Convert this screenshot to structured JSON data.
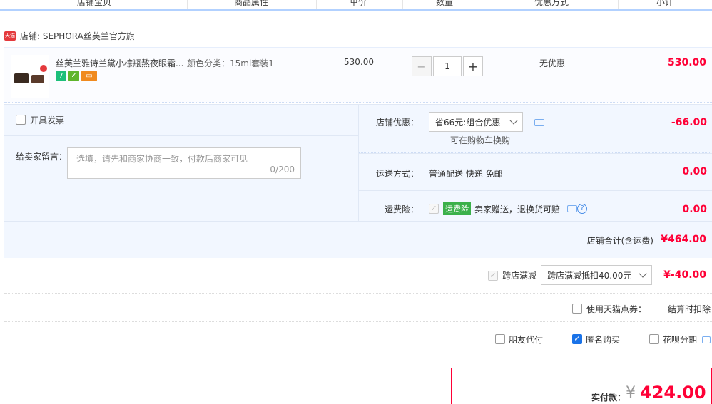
{
  "header": {
    "cols": [
      "店铺宝贝",
      "商品属性",
      "单价",
      "数量",
      "优惠方式",
      "小计"
    ]
  },
  "shop": {
    "badge": "天猫",
    "label": "店铺: SEPHORA丝芙兰官方旗"
  },
  "item": {
    "title": "丝芙兰雅诗兰黛小棕瓶熬夜眼霜...",
    "attr": "颜色分类：15ml套装1",
    "price": "530.00",
    "qty": "1",
    "minus": "−",
    "plus": "+",
    "discount": "无优惠",
    "subtotal": "530.00"
  },
  "options": {
    "invoice_label": "开具发票",
    "message_label": "给卖家留言：",
    "message_placeholder": "选填，请先和商家协商一致，付款后商家可见",
    "message_count": "0/200",
    "shop_discount_label": "店铺优惠：",
    "shop_discount_value": "省66元:组合优惠",
    "shop_discount_note": "可在购物车换购",
    "shop_discount_amount": "-66.00",
    "shipping_label": "运送方式：",
    "shipping_value": "普通配送 快递 免邮",
    "shipping_amount": "0.00",
    "insurance_label": "运费险：",
    "insurance_tag": "运费险",
    "insurance_text": "卖家赠送，退换货可赔",
    "insurance_amount": "0.00"
  },
  "shop_total": {
    "label": "店铺合计(含运费)",
    "amount": "¥464.00"
  },
  "cross_store": {
    "label": "跨店满减",
    "select": "跨店满减抵扣40.00元",
    "amount": "¥-40.00"
  },
  "tmall_points": {
    "label": "使用天猫点券：",
    "note": "结算时扣除"
  },
  "pay_options": {
    "friend": "朋友代付",
    "anonymous": "匿名购买",
    "huabei": "花呗分期"
  },
  "final": {
    "label": "实付款：",
    "currency": "¥",
    "amount": "424.00"
  }
}
